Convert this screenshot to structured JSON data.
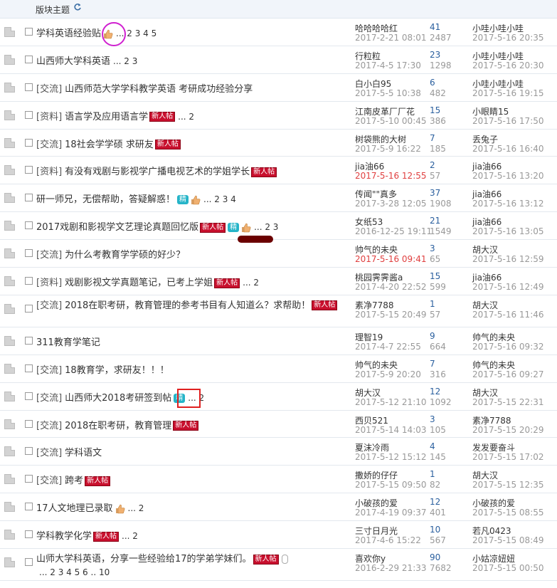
{
  "header": {
    "title": "版块主题",
    "refresh_icon": "refresh-icon"
  },
  "colors": {
    "new_tag": "#c8102e",
    "jing_tag": "#25b4c8",
    "reply_count": "#2a5f9e",
    "red_date": "#e04040",
    "circle_mark": "#d020d0",
    "box_mark": "#e02020"
  },
  "threads": [
    {
      "cat": "",
      "title": "学科英语经验贴",
      "new": false,
      "jing": false,
      "thumb": true,
      "pages": "... 2 3 4 5",
      "author": "哈哈哈哈红",
      "adate": "2017-2-21 08:01",
      "adate_red": false,
      "replies": "41",
      "views": "2487",
      "lastby": "小哇小哇小哇",
      "lastdate": "2017-5-16 20:35"
    },
    {
      "cat": "",
      "title": "山西师大学科英语",
      "new": false,
      "jing": false,
      "thumb": false,
      "pages": "... 2 3",
      "author": "行粒粒",
      "adate": "2017-4-5 17:30",
      "adate_red": false,
      "replies": "23",
      "views": "1298",
      "lastby": "小哇小哇小哇",
      "lastdate": "2017-5-16 20:30"
    },
    {
      "cat": "[交流]",
      "title": "山西师范大学学科教学英语 考研成功经验分享",
      "new": false,
      "jing": false,
      "thumb": false,
      "pages": "",
      "author": "白小白95",
      "adate": "2017-5-5 10:38",
      "adate_red": false,
      "replies": "6",
      "views": "482",
      "lastby": "小哇小哇小哇",
      "lastdate": "2017-5-16 19:15"
    },
    {
      "cat": "[资料]",
      "title": "语言学及应用语言学",
      "new": true,
      "jing": false,
      "thumb": false,
      "pages": "... 2",
      "author": "江南皮革厂厂花",
      "adate": "2017-5-10 00:45",
      "adate_red": false,
      "replies": "15",
      "views": "386",
      "lastby": "小眼睛15",
      "lastdate": "2017-5-16 17:50"
    },
    {
      "cat": "[交流]",
      "title": "18社会学学硕 求研友",
      "new": true,
      "jing": false,
      "thumb": false,
      "pages": "",
      "author": "树袋熊的大树",
      "adate": "2017-5-9 16:22",
      "adate_red": false,
      "replies": "7",
      "views": "185",
      "lastby": "丢兔子",
      "lastdate": "2017-5-16 16:40"
    },
    {
      "cat": "[资料]",
      "title": "有没有戏剧与影视学广播电视艺术的学姐学长",
      "new": true,
      "jing": false,
      "thumb": false,
      "pages": "",
      "author": "jia油66",
      "adate": "2017-5-16 12:55",
      "adate_red": true,
      "replies": "2",
      "views": "57",
      "lastby": "jia油66",
      "lastdate": "2017-5-16 13:20"
    },
    {
      "cat": "",
      "title": "研一师兄，无偿帮助，答疑解惑！",
      "new": false,
      "jing": true,
      "thumb": true,
      "pages": "... 2 3 4",
      "author": "传闻\"\"真多",
      "adate": "2017-3-28 12:05",
      "adate_red": false,
      "replies": "37",
      "views": "1908",
      "lastby": "jia油66",
      "lastdate": "2017-5-16 13:12"
    },
    {
      "cat": "",
      "title": "2017戏剧和影视学文艺理论真题回忆版",
      "new": true,
      "jing": true,
      "thumb": true,
      "pages": "... 2 3",
      "author": "女纸53",
      "adate": "2016-12-25 19:11",
      "adate_red": false,
      "replies": "21",
      "views": "1549",
      "lastby": "jia油66",
      "lastdate": "2017-5-16 13:05"
    },
    {
      "cat": "[交流]",
      "title": "为什么考教育学学硕的好少？",
      "new": false,
      "jing": false,
      "thumb": false,
      "pages": "",
      "author": "帅气的未央",
      "adate": "2017-5-16 09:41",
      "adate_red": true,
      "replies": "3",
      "views": "65",
      "lastby": "胡大汉",
      "lastdate": "2017-5-16 12:59"
    },
    {
      "cat": "[资料]",
      "title": "戏剧影视文学真题笔记，已考上学姐",
      "new": true,
      "jing": false,
      "thumb": false,
      "pages": "... 2",
      "author": "桃园霁霁酱a",
      "adate": "2017-4-20 22:52",
      "adate_red": false,
      "replies": "15",
      "views": "599",
      "lastby": "jia油66",
      "lastdate": "2017-5-16 12:49"
    },
    {
      "cat": "[交流]",
      "title": "2018在职考研，教育管理的参考书目有人知道么？求帮助！",
      "new": true,
      "jing": false,
      "thumb": false,
      "pages": "",
      "tall": true,
      "author": "素净7788",
      "adate": "2017-5-15 20:49",
      "adate_red": false,
      "replies": "1",
      "views": "57",
      "lastby": "胡大汉",
      "lastdate": "2017-5-16 11:46"
    },
    {
      "cat": "",
      "title": "311教育学笔记",
      "new": false,
      "jing": false,
      "thumb": false,
      "pages": "",
      "author": "理智19",
      "adate": "2017-4-7 22:55",
      "adate_red": false,
      "replies": "9",
      "views": "664",
      "lastby": "帅气的未央",
      "lastdate": "2017-5-16 09:32"
    },
    {
      "cat": "[交流]",
      "title": "18教育学，求研友！！！",
      "new": false,
      "jing": false,
      "thumb": false,
      "pages": "",
      "author": "帅气的未央",
      "adate": "2017-5-9 20:20",
      "adate_red": false,
      "replies": "7",
      "views": "316",
      "lastby": "帅气的未央",
      "lastdate": "2017-5-16 09:27"
    },
    {
      "cat": "[交流]",
      "title": "山西师大2018考研签到帖",
      "new": false,
      "jing": true,
      "thumb": false,
      "pages": "... 2",
      "author": "胡大汉",
      "adate": "2017-5-12 21:10",
      "adate_red": false,
      "replies": "12",
      "views": "1092",
      "lastby": "胡大汉",
      "lastdate": "2017-5-15 22:31"
    },
    {
      "cat": "[交流]",
      "title": "2018在职考研，教育管理",
      "new": true,
      "jing": false,
      "thumb": false,
      "pages": "",
      "author": "西贝521",
      "adate": "2017-5-14 14:03",
      "adate_red": false,
      "replies": "3",
      "views": "105",
      "lastby": "素净7788",
      "lastdate": "2017-5-15 20:29"
    },
    {
      "cat": "[交流]",
      "title": "学科语文",
      "new": false,
      "jing": false,
      "thumb": false,
      "pages": "",
      "author": "夏沫冷雨",
      "adate": "2017-5-12 15:12",
      "adate_red": false,
      "replies": "4",
      "views": "145",
      "lastby": "发发要奋斗",
      "lastdate": "2017-5-15 17:02"
    },
    {
      "cat": "[交流]",
      "title": "跨考",
      "new": true,
      "jing": false,
      "thumb": false,
      "pages": "",
      "author": "撒娇的仔仔",
      "adate": "2017-5-15 09:50",
      "adate_red": false,
      "replies": "1",
      "views": "82",
      "lastby": "胡大汉",
      "lastdate": "2017-5-15 12:35"
    },
    {
      "cat": "",
      "title": "17人文地理已录取",
      "new": false,
      "jing": false,
      "thumb": true,
      "pages": "... 2",
      "author": "小破孩的爱",
      "adate": "2017-4-19 09:37",
      "adate_red": false,
      "replies": "12",
      "views": "401",
      "lastby": "小破孩的爱",
      "lastdate": "2017-5-15 08:55"
    },
    {
      "cat": "",
      "title": "学科教学化学",
      "new": true,
      "jing": false,
      "thumb": false,
      "pages": "... 2",
      "author": "三寸日月光",
      "adate": "2017-4-6 15:22",
      "adate_red": false,
      "replies": "10",
      "views": "567",
      "lastby": "若凡0423",
      "lastdate": "2017-5-15 08:49"
    },
    {
      "cat": "",
      "title": "山师大学科英语，分享一些经验给17的学弟学妹们。",
      "new": true,
      "jing": false,
      "thumb": false,
      "clip": true,
      "pages": "... 2 3 4 5 6 .. 10",
      "tall": true,
      "author": "喜欢你y",
      "adate": "2016-2-29 21:33",
      "adate_red": false,
      "replies": "90",
      "views": "7682",
      "lastby": "小姑凉妞妞",
      "lastdate": "2017-5-15 00:50"
    }
  ],
  "labels": {
    "new_tag": "新人帖",
    "jing_tag": "精"
  }
}
